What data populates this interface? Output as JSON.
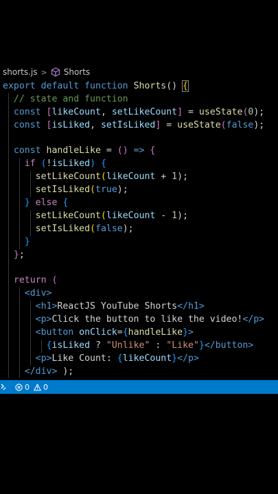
{
  "breadcrumb": {
    "file": "shorts.js",
    "symbol": "Shorts"
  },
  "code": {
    "l1": {
      "a": "export default function ",
      "b": "Shorts",
      "c": "() ",
      "d": "{"
    },
    "l2": {
      "a": "// state and function"
    },
    "l3": {
      "a": "const ",
      "b": "[",
      "c": "likeCount",
      "d": ", ",
      "e": "setLikeCount",
      "f": "]",
      "g": " = ",
      "h": "useState",
      "i": "(",
      "j": "0",
      "k": ");"
    },
    "l4": {
      "a": "const ",
      "b": "[",
      "c": "isLiked",
      "d": ", ",
      "e": "setIsLiked",
      "f": "]",
      "g": " = ",
      "h": "useState",
      "i": "(",
      "j": "false",
      "k": ");"
    },
    "l6": {
      "a": "const ",
      "b": "handleLike",
      "c": " = ",
      "d": "()",
      "e": " => ",
      "f": "{"
    },
    "l7": {
      "a": "if ",
      "b": "(",
      "c": "!",
      "d": "isLiked",
      "e": ")",
      "f": " {"
    },
    "l8": {
      "a": "setLikeCount",
      "b": "(",
      "c": "likeCount",
      "d": " + ",
      "e": "1",
      "f": ");"
    },
    "l9": {
      "a": "setIsLiked",
      "b": "(",
      "c": "true",
      "d": ");"
    },
    "l10": {
      "a": "}",
      "b": " else ",
      "c": "{"
    },
    "l11": {
      "a": "setLikeCount",
      "b": "(",
      "c": "likeCount",
      "d": " - ",
      "e": "1",
      "f": ");"
    },
    "l12": {
      "a": "setIsLiked",
      "b": "(",
      "c": "false",
      "d": ");"
    },
    "l13": {
      "a": "}"
    },
    "l14": {
      "a": "}",
      "b": ";"
    },
    "l16": {
      "a": "return ",
      "b": "("
    },
    "l17": {
      "a": "<div>"
    },
    "l18": {
      "a": "<h1>",
      "b": "ReactJS YouTube Shorts",
      "c": "</h1>"
    },
    "l19": {
      "a": "<p>",
      "b": "Click the button to like the video!",
      "c": "</p>"
    },
    "l20": {
      "a": "<button ",
      "b": "onClick",
      "c": "=",
      "d": "{",
      "e": "handleLike",
      "f": "}",
      "g": ">"
    },
    "l21": {
      "a": "{",
      "b": "isLiked",
      "c": " ? ",
      "d": "\"Unlike\"",
      "e": " : ",
      "f": "\"Like\"",
      "g": "}",
      "h": "</button>"
    },
    "l22": {
      "a": "<p>",
      "b": "Like Count: ",
      "c": "{",
      "d": "likeCount",
      "e": "}",
      "f": "</p>"
    },
    "l23": {
      "a": "</div>",
      "b": " );"
    }
  },
  "statusbar": {
    "errors": "0",
    "warnings": "0"
  },
  "colors": {
    "background": "#000000",
    "statusbar": "#007acc"
  },
  "icons": {
    "breadcrumb_symbol": "cube-icon",
    "remote": "remote-icon",
    "errors": "error-icon",
    "warnings": "warning-icon"
  }
}
